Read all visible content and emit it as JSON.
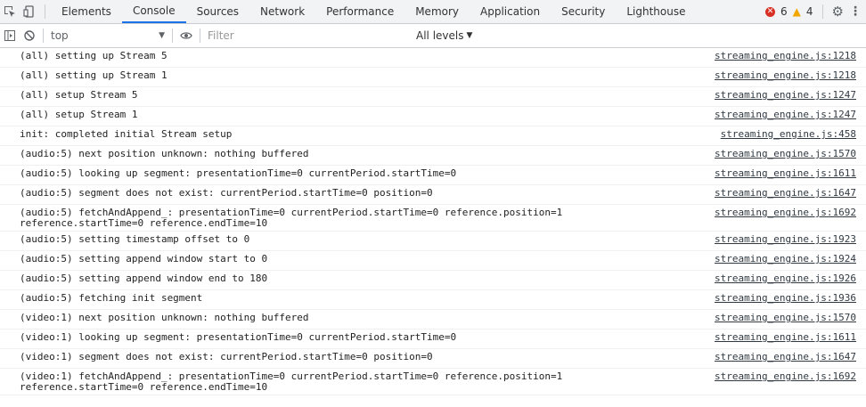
{
  "tabs": [
    "Elements",
    "Console",
    "Sources",
    "Network",
    "Performance",
    "Memory",
    "Application",
    "Security",
    "Lighthouse"
  ],
  "active_tab": "Console",
  "status": {
    "errors": "6",
    "warnings": "4"
  },
  "toolbar": {
    "context": "top",
    "filter_placeholder": "Filter",
    "levels": "All levels"
  },
  "messages": [
    {
      "text": "(all) setting up Stream 5",
      "source": "streaming_engine.js:1218"
    },
    {
      "text": "(all) setting up Stream 1",
      "source": "streaming_engine.js:1218"
    },
    {
      "text": "(all) setup Stream 5",
      "source": "streaming_engine.js:1247"
    },
    {
      "text": "(all) setup Stream 1",
      "source": "streaming_engine.js:1247"
    },
    {
      "text": "init: completed initial Stream setup",
      "source": "streaming_engine.js:458"
    },
    {
      "text": "(audio:5) next position unknown: nothing buffered",
      "source": "streaming_engine.js:1570"
    },
    {
      "text": "(audio:5) looking up segment: presentationTime=0 currentPeriod.startTime=0",
      "source": "streaming_engine.js:1611"
    },
    {
      "text": "(audio:5) segment does not exist: currentPeriod.startTime=0 position=0",
      "source": "streaming_engine.js:1647"
    },
    {
      "text": "(audio:5) fetchAndAppend_: presentationTime=0 currentPeriod.startTime=0 reference.position=1\nreference.startTime=0 reference.endTime=10",
      "source": "streaming_engine.js:1692"
    },
    {
      "text": "(audio:5) setting timestamp offset to 0",
      "source": "streaming_engine.js:1923"
    },
    {
      "text": "(audio:5) setting append window start to 0",
      "source": "streaming_engine.js:1924"
    },
    {
      "text": "(audio:5) setting append window end to 180",
      "source": "streaming_engine.js:1926"
    },
    {
      "text": "(audio:5) fetching init segment",
      "source": "streaming_engine.js:1936"
    },
    {
      "text": "(video:1) next position unknown: nothing buffered",
      "source": "streaming_engine.js:1570"
    },
    {
      "text": "(video:1) looking up segment: presentationTime=0 currentPeriod.startTime=0",
      "source": "streaming_engine.js:1611"
    },
    {
      "text": "(video:1) segment does not exist: currentPeriod.startTime=0 position=0",
      "source": "streaming_engine.js:1647"
    },
    {
      "text": "(video:1) fetchAndAppend_: presentationTime=0 currentPeriod.startTime=0 reference.position=1\nreference.startTime=0 reference.endTime=10",
      "source": "streaming_engine.js:1692"
    }
  ]
}
